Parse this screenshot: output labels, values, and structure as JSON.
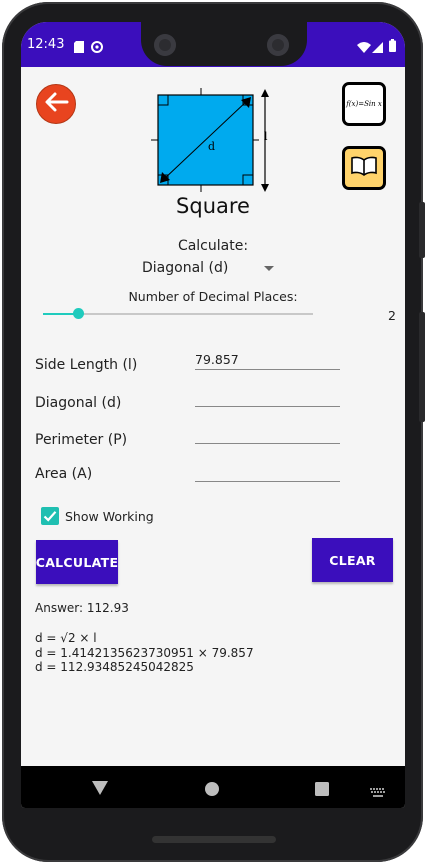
{
  "status_bar": {
    "time": "12:43",
    "background_color": "#3b0ebc",
    "icons": [
      "sd-card-icon",
      "sync-icon",
      "wifi-icon",
      "signal-icon",
      "battery-icon"
    ]
  },
  "header": {
    "back_icon": "arrow-left-icon",
    "formula_icon_text": "f(x)=Sin x",
    "book_icon": "book-icon",
    "title": "Square"
  },
  "diagram": {
    "diagonal_label": "d",
    "side_label": "l",
    "fill_color": "#00aaee"
  },
  "calculate": {
    "label": "Calculate:",
    "selected": "Diagonal (d)"
  },
  "decimals": {
    "label": "Number of Decimal Places:",
    "value": "2",
    "slider_fraction": 0.13
  },
  "fields": [
    {
      "label": "Side Length (l)",
      "value": "79.857"
    },
    {
      "label": "Diagonal (d)",
      "value": ""
    },
    {
      "label": "Perimeter (P)",
      "value": ""
    },
    {
      "label": "Area (A)",
      "value": ""
    }
  ],
  "show_working": {
    "label": "Show Working",
    "checked": true
  },
  "buttons": {
    "calculate": "CALCULATE",
    "clear": "CLEAR"
  },
  "result": {
    "answer": "Answer: 112.93",
    "working": [
      "d = √2 × l",
      "d = 1.4142135623730951 × 79.857",
      "d = 112.934852450428​25"
    ]
  },
  "nav_bar": {
    "icons": [
      "back-triangle-icon",
      "home-circle-icon",
      "recents-square-icon",
      "keyboard-icon"
    ]
  },
  "accent_color": "#1fcbbd"
}
